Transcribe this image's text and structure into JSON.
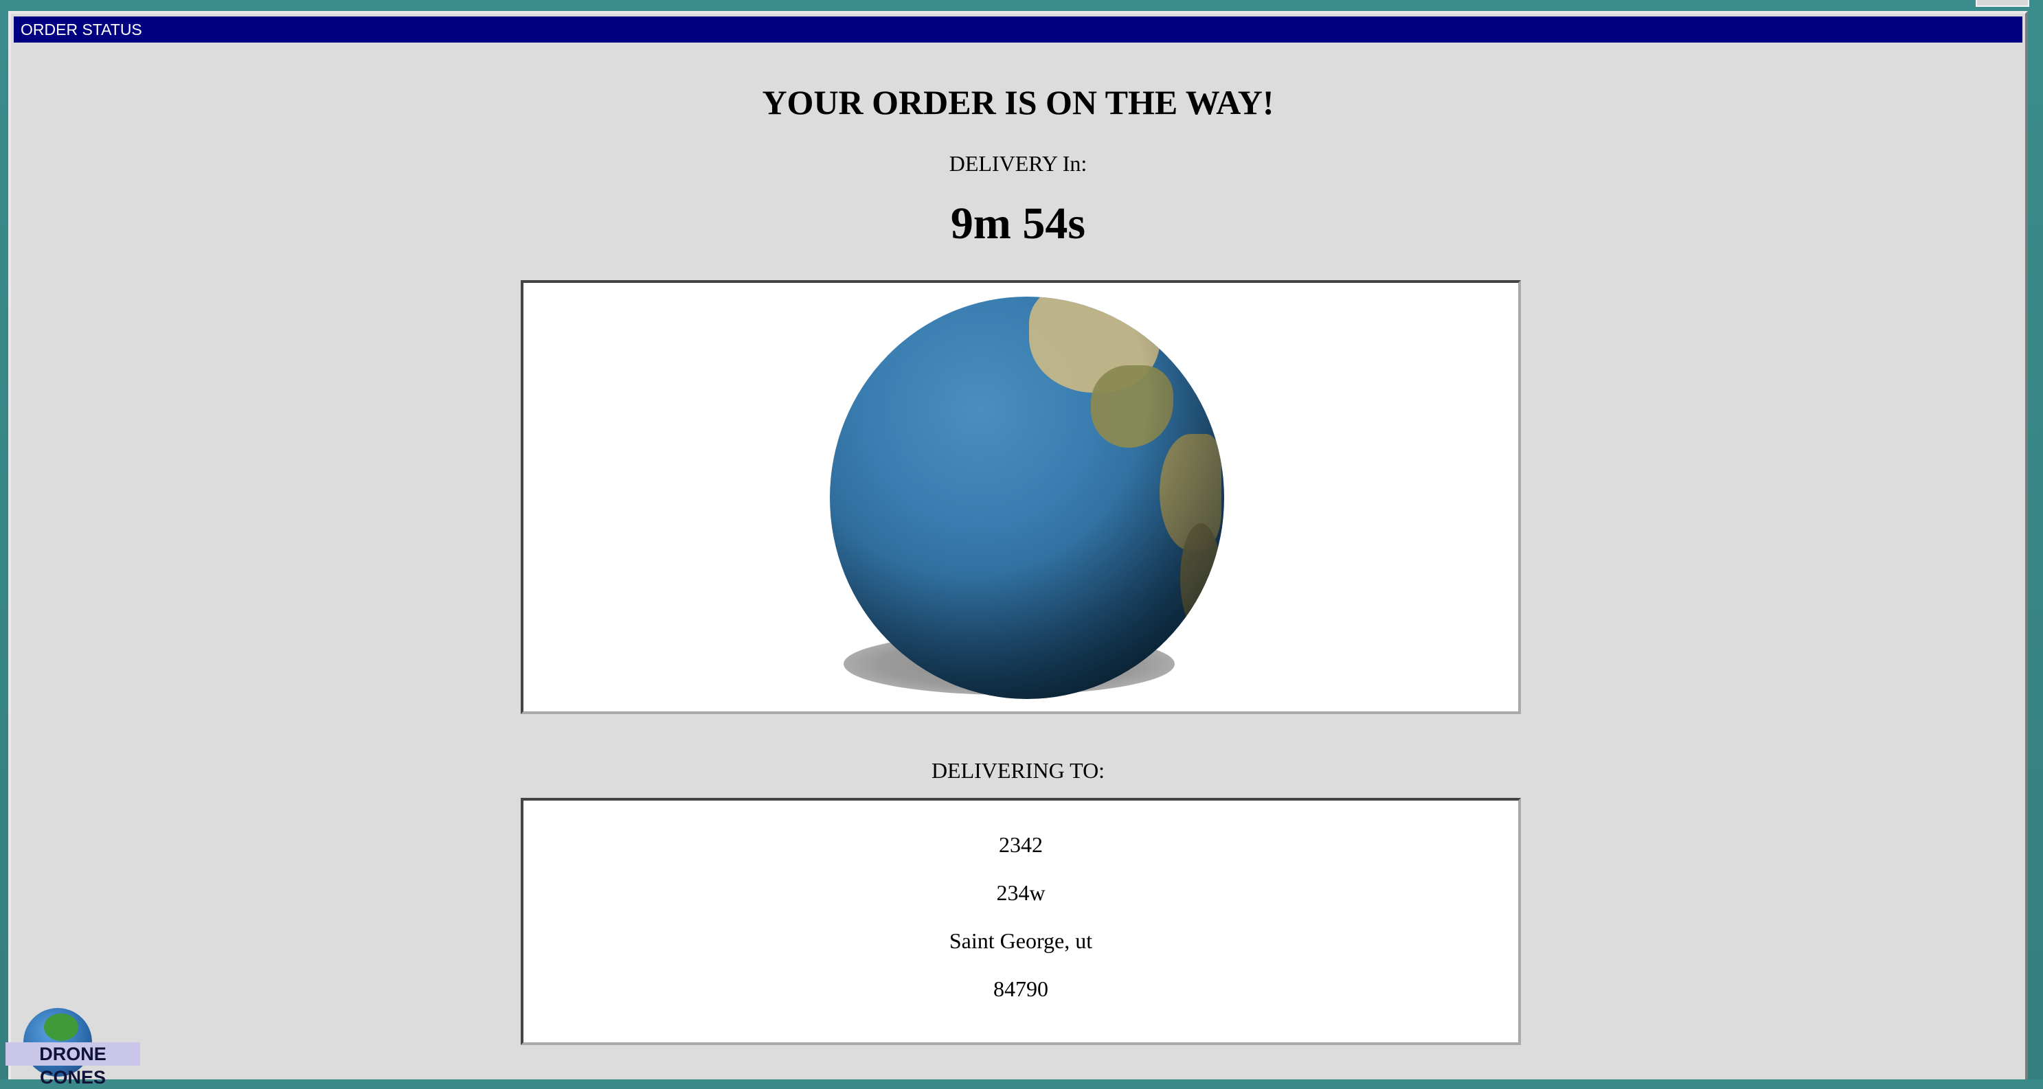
{
  "window": {
    "title": "ORDER STATUS"
  },
  "status": {
    "headline": "YOUR ORDER IS ON THE WAY!",
    "delivery_label": "DELIVERY In:",
    "countdown": "9m 54s"
  },
  "delivery": {
    "label": "DELIVERING TO:",
    "address_lines": [
      "2342",
      "234w",
      "Saint George, ut",
      "84790"
    ]
  },
  "logo": {
    "text": "DRONE CONES"
  },
  "colors": {
    "titlebar": "#000080",
    "window_bg": "#dcdcdc",
    "desktop": "#3a8a8a"
  }
}
